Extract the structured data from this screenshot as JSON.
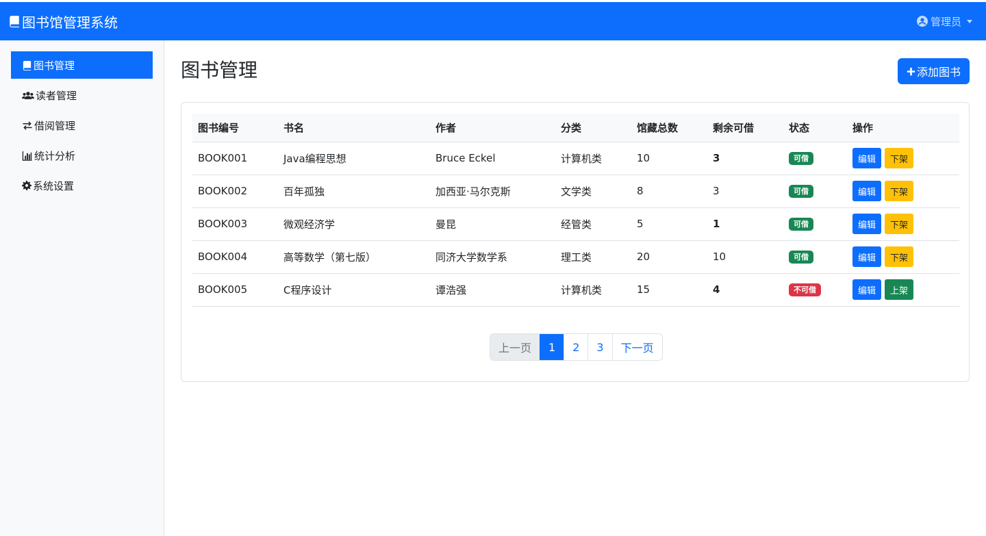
{
  "app": {
    "title": "图书馆管理系统"
  },
  "header": {
    "user": "管理员"
  },
  "sidebar": {
    "items": [
      {
        "label": "图书管理",
        "icon": "book-icon",
        "active": true
      },
      {
        "label": "读者管理",
        "icon": "users-icon",
        "active": false
      },
      {
        "label": "借阅管理",
        "icon": "exchange-icon",
        "active": false
      },
      {
        "label": "统计分析",
        "icon": "bar-chart-icon",
        "active": false
      },
      {
        "label": "系统设置",
        "icon": "gear-icon",
        "active": false
      }
    ]
  },
  "main": {
    "title": "图书管理",
    "add_button": "添加图书"
  },
  "table": {
    "columns": [
      "图书编号",
      "书名",
      "作者",
      "分类",
      "馆藏总数",
      "剩余可借",
      "状态",
      "操作"
    ],
    "rows": [
      {
        "id": "BOOK001",
        "name": "Java编程思想",
        "author": "Bruce Eckel",
        "category": "计算机类",
        "total": "10",
        "remaining": "3",
        "remaining_bold": true,
        "status": "可借",
        "status_type": "ok",
        "edit": "编辑",
        "action": "下架",
        "action_type": "down"
      },
      {
        "id": "BOOK002",
        "name": "百年孤独",
        "author": "加西亚·马尔克斯",
        "category": "文学类",
        "total": "8",
        "remaining": "3",
        "remaining_bold": false,
        "status": "可借",
        "status_type": "ok",
        "edit": "编辑",
        "action": "下架",
        "action_type": "down"
      },
      {
        "id": "BOOK003",
        "name": "微观经济学",
        "author": "曼昆",
        "category": "经管类",
        "total": "5",
        "remaining": "1",
        "remaining_bold": true,
        "status": "可借",
        "status_type": "ok",
        "edit": "编辑",
        "action": "下架",
        "action_type": "down"
      },
      {
        "id": "BOOK004",
        "name": "高等数学（第七版）",
        "author": "同济大学数学系",
        "category": "理工类",
        "total": "20",
        "remaining": "10",
        "remaining_bold": false,
        "status": "可借",
        "status_type": "ok",
        "edit": "编辑",
        "action": "下架",
        "action_type": "down"
      },
      {
        "id": "BOOK005",
        "name": "C程序设计",
        "author": "谭浩强",
        "category": "计算机类",
        "total": "15",
        "remaining": "4",
        "remaining_bold": true,
        "status": "不可借",
        "status_type": "no",
        "edit": "编辑",
        "action": "上架",
        "action_type": "up"
      }
    ]
  },
  "pagination": {
    "prev": "上一页",
    "pages": [
      "1",
      "2",
      "3"
    ],
    "active": "1",
    "next": "下一页"
  },
  "colors": {
    "primary": "#0d6efd",
    "success": "#198754",
    "danger": "#dc3545",
    "warning": "#ffc107"
  }
}
